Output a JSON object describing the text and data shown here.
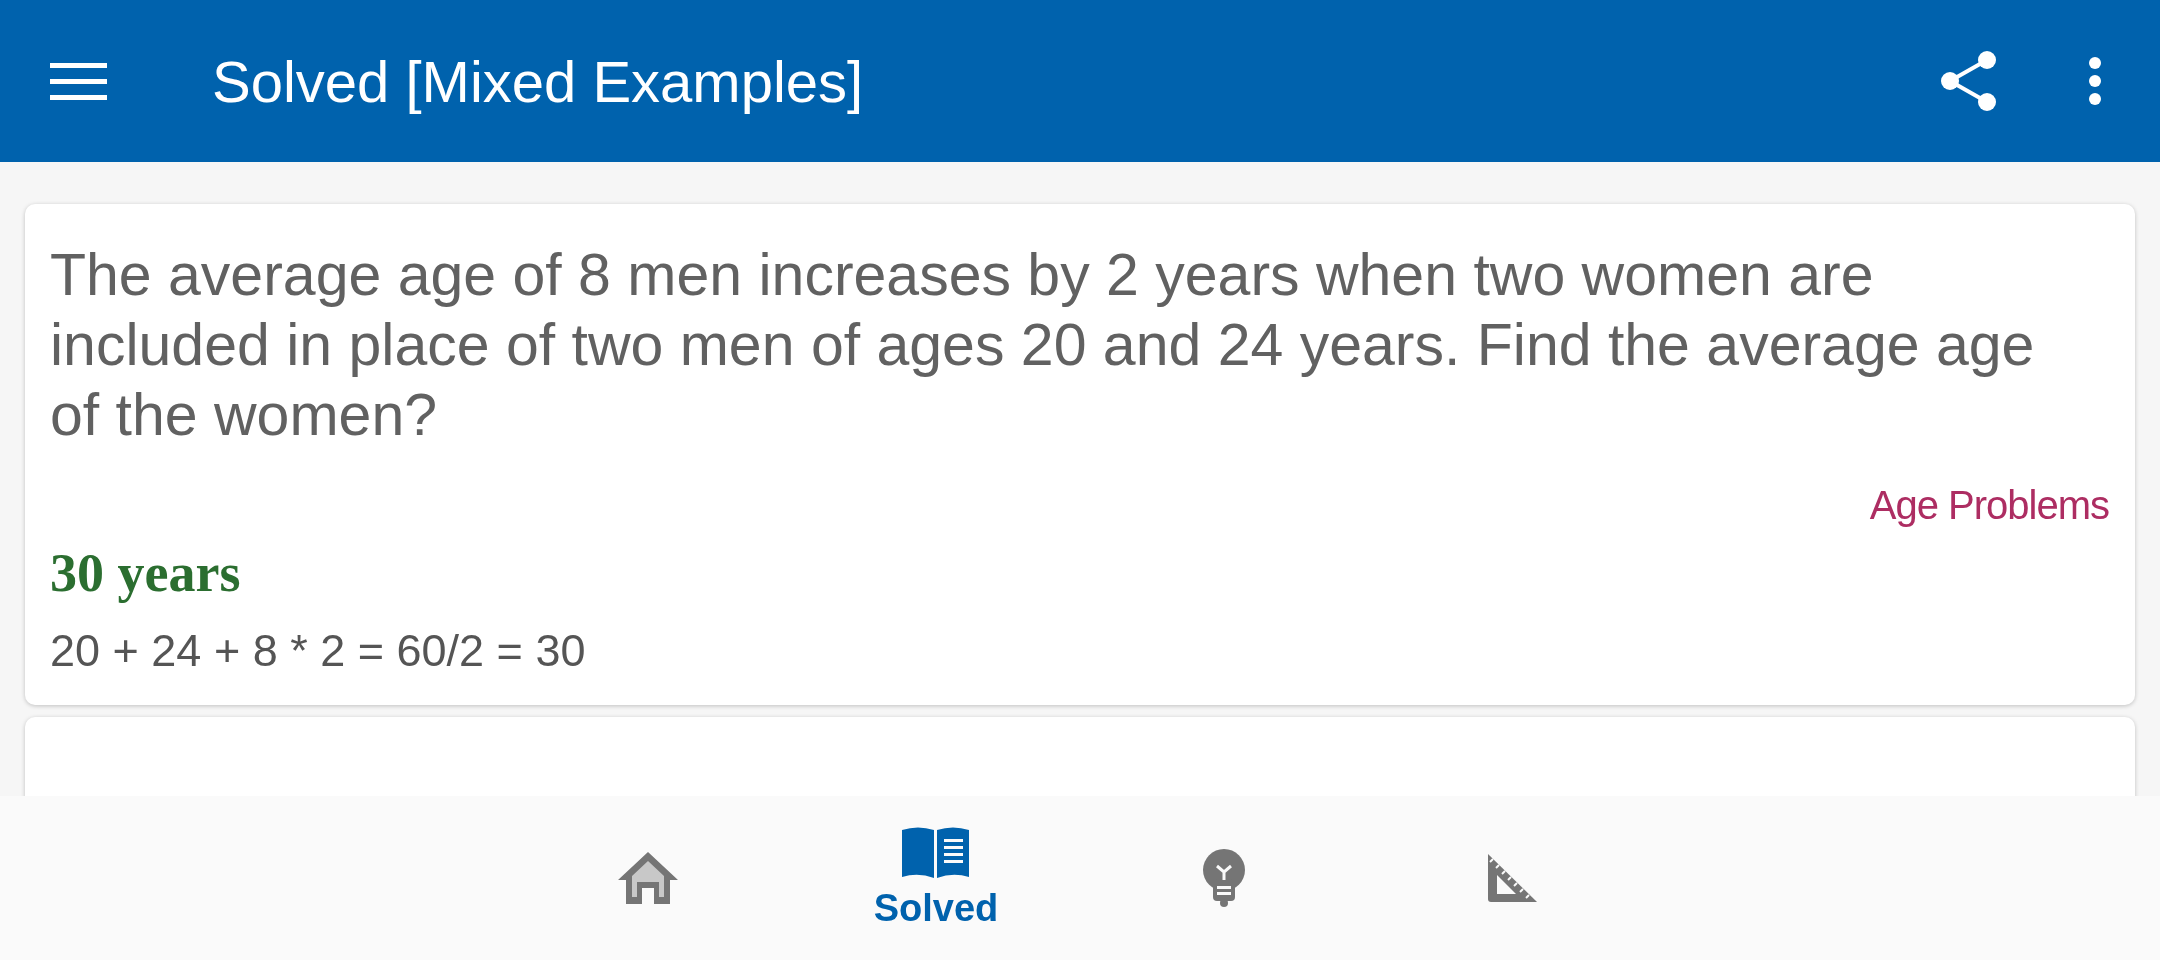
{
  "app_bar": {
    "title": "Solved [Mixed Examples]"
  },
  "cards": [
    {
      "question": "The average age of 8 men increases by 2 years when two women are included in place of two men of ages 20 and 24 years. Find the average age of the women?",
      "category": "Age Problems",
      "answer": "30 years",
      "solution": "20 + 24 + 8 * 2 = 60/2 = 30"
    }
  ],
  "bottom_nav": {
    "items": [
      {
        "selected": false
      },
      {
        "label": "Solved",
        "selected": true
      },
      {
        "selected": false
      },
      {
        "selected": false
      }
    ]
  }
}
